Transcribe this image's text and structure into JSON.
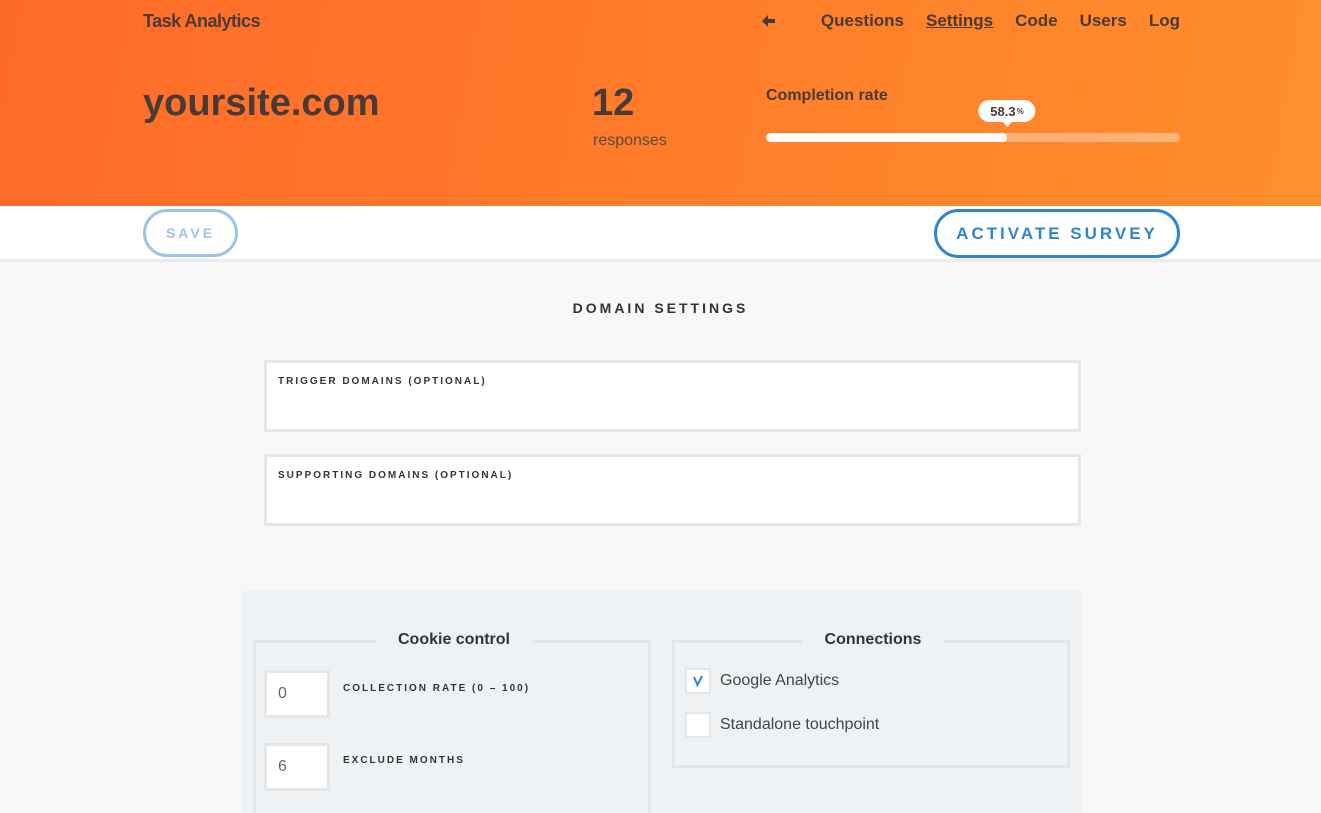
{
  "app": {
    "brand": "Task Analytics"
  },
  "nav": {
    "back_icon": "arrow-left-icon",
    "items": [
      {
        "label": "Questions",
        "active": false
      },
      {
        "label": "Settings",
        "active": true
      },
      {
        "label": "Code",
        "active": false
      },
      {
        "label": "Users",
        "active": false
      },
      {
        "label": "Log",
        "active": false
      }
    ]
  },
  "summary": {
    "site": "yoursite.com",
    "responses_count": "12",
    "responses_label": "responses",
    "completion_label": "Completion rate",
    "completion_value": "58.3",
    "completion_unit": "%",
    "completion_fraction": 0.583
  },
  "toolbar": {
    "save_label": "SAVE",
    "activate_label": "ACTIVATE SURVEY"
  },
  "domain_settings": {
    "title": "DOMAIN SETTINGS",
    "trigger_label": "TRIGGER DOMAINS (OPTIONAL)",
    "trigger_value": "",
    "supporting_label": "SUPPORTING DOMAINS (OPTIONAL)",
    "supporting_value": ""
  },
  "cookie_control": {
    "title": "Cookie control",
    "collection_rate_label": "COLLECTION RATE (0 – 100)",
    "collection_rate_value": "0",
    "exclude_months_label": "EXCLUDE MONTHS",
    "exclude_months_value": "6"
  },
  "connections": {
    "title": "Connections",
    "items": [
      {
        "label": "Google Analytics",
        "checked": true
      },
      {
        "label": "Standalone touchpoint",
        "checked": false
      }
    ]
  },
  "colors": {
    "accent": "#2f86d0",
    "save_muted": "#9cc4e8",
    "header_start": "#ff6a2a",
    "header_end": "#ff8f2c"
  }
}
